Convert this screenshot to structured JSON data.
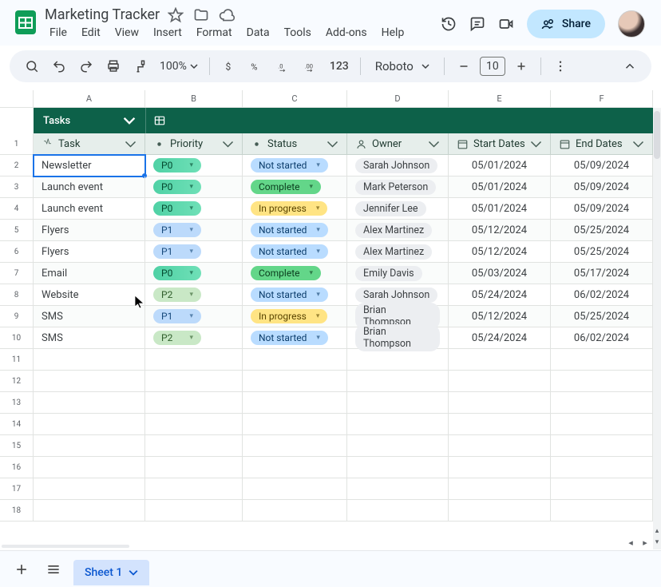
{
  "doc": {
    "title": "Marketing Tracker"
  },
  "menus": [
    "File",
    "Edit",
    "View",
    "Insert",
    "Format",
    "Data",
    "Tools",
    "Add-ons",
    "Help"
  ],
  "share_label": "Share",
  "toolbar": {
    "zoom": "100%",
    "font": "Roboto",
    "fontSize": "10",
    "fmt123": "123"
  },
  "columns": [
    "A",
    "B",
    "C",
    "D",
    "E",
    "F"
  ],
  "rowNumbers": [
    "1",
    "2",
    "3",
    "4",
    "5",
    "6",
    "7",
    "8",
    "9",
    "10",
    "11",
    "12",
    "13",
    "14",
    "15",
    "16",
    "17",
    "18"
  ],
  "table": {
    "name": "Tasks",
    "headers": {
      "task": "Task",
      "priority": "Priority",
      "status": "Status",
      "owner": "Owner",
      "start": "Start Dates",
      "end": "End Dates"
    },
    "rows": [
      {
        "task": "Newsletter",
        "priority": "P0",
        "status": "Not started",
        "owner": "Sarah Johnson",
        "start": "05/01/2024",
        "end": "05/09/2024"
      },
      {
        "task": "Launch event",
        "priority": "P0",
        "status": "Complete",
        "owner": "Mark Peterson",
        "start": "05/01/2024",
        "end": "05/09/2024"
      },
      {
        "task": "Launch event",
        "priority": "P0",
        "status": "In progress",
        "owner": "Jennifer Lee",
        "start": "05/01/2024",
        "end": "05/09/2024"
      },
      {
        "task": "Flyers",
        "priority": "P1",
        "status": "Not started",
        "owner": "Alex Martinez",
        "start": "05/12/2024",
        "end": "05/25/2024"
      },
      {
        "task": "Flyers",
        "priority": "P1",
        "status": "Not started",
        "owner": "Alex Martinez",
        "start": "05/12/2024",
        "end": "05/25/2024"
      },
      {
        "task": "Email",
        "priority": "P0",
        "status": "Complete",
        "owner": "Emily Davis",
        "start": "05/03/2024",
        "end": "05/17/2024"
      },
      {
        "task": "Website",
        "priority": "P2",
        "status": "Not started",
        "owner": "Sarah Johnson",
        "start": "05/24/2024",
        "end": "06/02/2024"
      },
      {
        "task": "SMS",
        "priority": "P1",
        "status": "In progress",
        "owner": "Brian Thompson",
        "start": "05/12/2024",
        "end": "05/25/2024"
      },
      {
        "task": "SMS",
        "priority": "P2",
        "status": "Not started",
        "owner": "Brian Thompson",
        "start": "05/24/2024",
        "end": "06/02/2024"
      }
    ]
  },
  "sheetTab": "Sheet 1"
}
